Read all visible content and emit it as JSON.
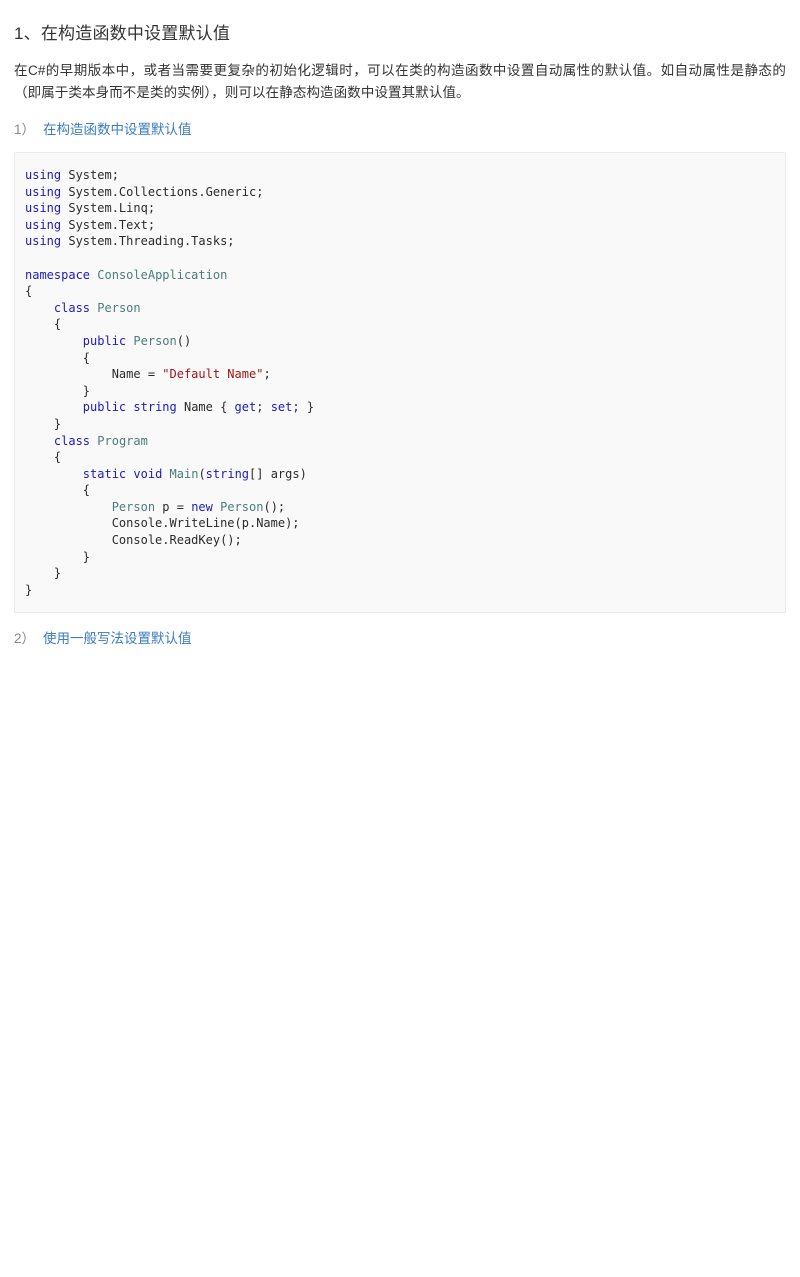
{
  "document": {
    "section_heading": "1、在构造函数中设置默认值",
    "paragraph": "在C#的早期版本中，或者当需要更复杂的初始化逻辑时，可以在类的构造函数中设置自动属性的默认值。如自动属性是静态的（即属于类本身而不是类的实例），则可以在静态构造函数中设置其默认值。",
    "items": [
      {
        "number": "1）",
        "label": "在构造函数中设置默认值"
      },
      {
        "number": "2）",
        "label": "使用一般写法设置默认值"
      }
    ],
    "code_block": {
      "language": "csharp",
      "lines": [
        "using System;",
        "using System.Collections.Generic;",
        "using System.Linq;",
        "using System.Text;",
        "using System.Threading.Tasks;",
        "",
        "namespace ConsoleApplication",
        "{",
        "    class Person",
        "    {",
        "        public Person()",
        "        {",
        "            Name = \"Default Name\";",
        "        }",
        "        public string Name { get; set; }",
        "    }",
        "    class Program",
        "    {",
        "        static void Main(string[] args)",
        "        {",
        "            Person p = new Person();",
        "            Console.WriteLine(p.Name);",
        "            Console.ReadKey();",
        "        }",
        "    }",
        "}"
      ]
    }
  },
  "colors": {
    "page_background": "#ffffff",
    "text": "#333333",
    "link": "#3a7cc1",
    "list_number": "#888888",
    "code_background": "#f9f9fa",
    "code_border": "#eaeaea",
    "code_keyword": "#1b1bbf",
    "code_type": "#4a7d7d",
    "code_string": "#a31515",
    "code_plain": "#2b2b2b"
  }
}
